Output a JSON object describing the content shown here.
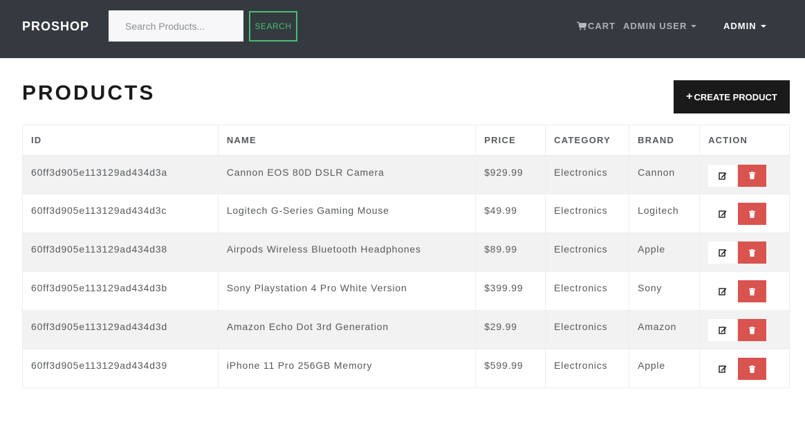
{
  "navbar": {
    "brand": "PROSHOP",
    "search_placeholder": "Search Products...",
    "search_button": "SEARCH",
    "cart_label": "CART",
    "user_menu": "ADMIN USER",
    "admin_menu": "ADMIN"
  },
  "page": {
    "title": "PRODUCTS",
    "create_button": "CREATE PRODUCT"
  },
  "table": {
    "headers": [
      "ID",
      "NAME",
      "PRICE",
      "CATEGORY",
      "BRAND",
      "ACTION"
    ],
    "rows": [
      {
        "id": "60ff3d905e113129ad434d3a",
        "name": "Cannon EOS 80D DSLR Camera",
        "price": "$929.99",
        "category": "Electronics",
        "brand": "Cannon"
      },
      {
        "id": "60ff3d905e113129ad434d3c",
        "name": "Logitech G-Series Gaming Mouse",
        "price": "$49.99",
        "category": "Electronics",
        "brand": "Logitech"
      },
      {
        "id": "60ff3d905e113129ad434d38",
        "name": "Airpods Wireless Bluetooth Headphones",
        "price": "$89.99",
        "category": "Electronics",
        "brand": "Apple"
      },
      {
        "id": "60ff3d905e113129ad434d3b",
        "name": "Sony Playstation 4 Pro White Version",
        "price": "$399.99",
        "category": "Electronics",
        "brand": "Sony"
      },
      {
        "id": "60ff3d905e113129ad434d3d",
        "name": "Amazon Echo Dot 3rd Generation",
        "price": "$29.99",
        "category": "Electronics",
        "brand": "Amazon"
      },
      {
        "id": "60ff3d905e113129ad434d39",
        "name": "iPhone 11 Pro 256GB Memory",
        "price": "$599.99",
        "category": "Electronics",
        "brand": "Apple"
      }
    ]
  },
  "icons": {
    "cart": "shopping-cart-icon",
    "create": "plus-icon",
    "edit": "edit-icon",
    "delete": "trash-icon"
  },
  "colors": {
    "navbar_bg": "#343a40",
    "accent_success": "#4bbf73",
    "danger": "#d9534f",
    "primary_dark": "#1a1a1a"
  }
}
